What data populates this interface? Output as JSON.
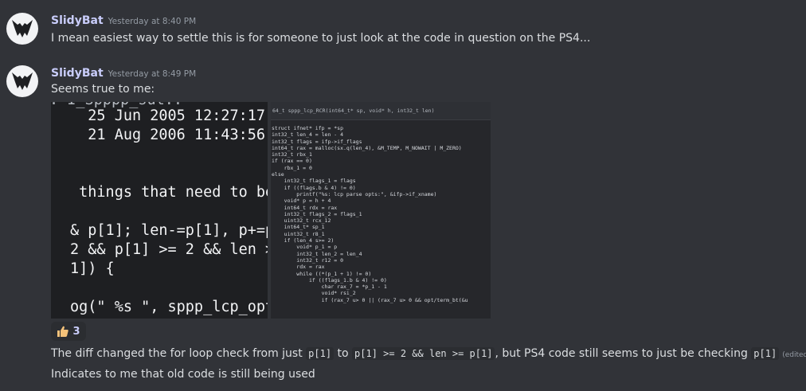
{
  "messages": [
    {
      "username": "SlidyBat",
      "timestamp": "Yesterday at 8:40 PM",
      "text": "I mean easiest way to settle this is for someone to just look at the code in question on the PS4..."
    },
    {
      "username": "SlidyBat",
      "timestamp": "Yesterday at 8:49 PM",
      "text": "Seems true to me:"
    }
  ],
  "attachments": {
    "left_image_code": "  25 Jun 2005 12:27:17\n  21 Aug 2006 11:43:56\n\n\n things that need to be r\n\n& p[1]; len-=p[1], p+=p[1\n2 && p[1] >= 2 && len >=\n1]) {\n\nog(\" %s \", sppp_lcp_opt_n",
    "left_image_topline": ": I_Spppp_sut..",
    "right_image_header": "64_t sppp_lcp_RCR(int64_t* sp, void* h, int32_t len)",
    "right_image_code": "struct ifnet* ifp = *sp\nint32_t len_4 = len - 4\nint32_t flags = ifp->if_flags\nint64_t rax = malloc(sx.q(len_4), &M_TEMP, M_NOWAIT | M_ZERO)\nint32_t rbx_1\nif (rax == 0)\n    rbx_1 = 0\nelse\n    int32_t flags_1 = flags\n    if ((flags.b & 4) != 0)\n        printf(\"%s: lcp parse opts:\", &ifp->if_xname)\n    void* p = h + 4\n    int64_t rdx = rax\n    int32_t flags_2 = flags_1\n    uint32_t rcx_12\n    int64_t* sp_1\n    uint32_t r8_1\n    if (len_4 s>= 2)\n        void* p_1 = p\n        int32_t len_2 = len_4\n        int32_t r12 = 0\n        rdx = rax\n        while ((*(p_1 + 1) != 0)\n            if ((flags_1.b & 4) != 0)\n                char rax_7 = *p_1 - 1\n                void* rsi_2\n                if (rax_7 u> 0 || (rax_7 u> 0 && opt/term_bt(&u"
  },
  "reaction": {
    "emoji": "thumbs-up",
    "count": "3"
  },
  "followups": {
    "line1_a": "The diff changed the for loop check from just",
    "line1_code1": "p[1]",
    "line1_b": "to",
    "line1_code2": "p[1] >= 2 && len >= p[1]",
    "line1_c": ", but PS4 code still seems to just be checking",
    "line1_code3": "p[1]",
    "edited": "(edited)",
    "line2": "Indicates to me that old code is still being used"
  },
  "colors": {
    "background": "#313338",
    "username": "#c9cdfb",
    "text": "#dbdee1",
    "muted": "#949ba4",
    "avatar_bg": "#f2f3f5"
  }
}
